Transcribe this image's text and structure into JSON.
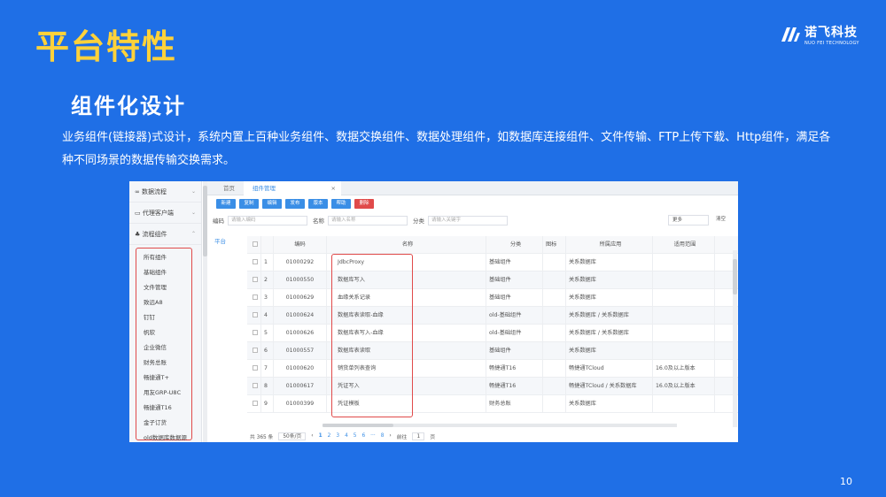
{
  "slide": {
    "title": "平台特性",
    "section_title": "组件化设计",
    "description": "业务组件(链接器)式设计，系统内置上百种业务组件、数据交换组件、数据处理组件，如数据库连接组件、文件传输、FTP上传下载、Http组件，满足各种不同场景的数据传输交换需求。",
    "page_number": "10",
    "logo_main": "诺飞科技",
    "logo_sub": "NUO FEI TECHNOLOGY"
  },
  "app": {
    "sidebar": {
      "groups": [
        {
          "label": "∞ 数据流程",
          "chevron": "⌄"
        },
        {
          "label": "▭ 代理客户端",
          "chevron": "⌄"
        },
        {
          "label": "♣ 流程组件",
          "chevron": "⌃"
        }
      ],
      "items": [
        "所有组件",
        "基础组件",
        "文件管理",
        "致远A8",
        "钉钉",
        "帆软",
        "企业微信",
        "财务总账",
        "畅捷通T+",
        "用友GRP-U8C",
        "畅捷通T16",
        "金子订货",
        "old数据库数据源"
      ]
    },
    "tabs": [
      {
        "label": "首页",
        "active": false
      },
      {
        "label": "组件管理",
        "active": true,
        "close": "×"
      }
    ],
    "toolbar": [
      "新建",
      "复制",
      "编辑",
      "发布",
      "版本",
      "帮助",
      "删除"
    ],
    "filter": {
      "code_label": "编码",
      "code_placeholder": "请输入编码",
      "name_label": "名称",
      "name_placeholder": "请输入名称",
      "cat_label": "分类",
      "cat_placeholder": "请输入关键字",
      "view_select": "更多",
      "clear_label": "清空"
    },
    "left_tag": "平台",
    "table": {
      "headers": {
        "code": "编码",
        "name": "名称",
        "cat": "分类",
        "mark": "图标",
        "app": "所属应用",
        "range": "适用范围"
      },
      "rows": [
        {
          "idx": "1",
          "code": "01000292",
          "name": "JdbcProxy",
          "cat": "基础组件",
          "app": "关系数据库",
          "range": ""
        },
        {
          "idx": "2",
          "code": "01000550",
          "name": "数据库写入",
          "cat": "基础组件",
          "app": "关系数据库",
          "range": ""
        },
        {
          "idx": "3",
          "code": "01000629",
          "name": "血缘关系记录",
          "cat": "基础组件",
          "app": "关系数据库",
          "range": ""
        },
        {
          "idx": "4",
          "code": "01000624",
          "name": "数据库表读取-血缘",
          "cat": "old-基础组件",
          "app": "关系数据库 / 关系数据库",
          "range": ""
        },
        {
          "idx": "5",
          "code": "01000626",
          "name": "数据库表写入-血缘",
          "cat": "old-基础组件",
          "app": "关系数据库 / 关系数据库",
          "range": ""
        },
        {
          "idx": "6",
          "code": "01000557",
          "name": "数据库表读取",
          "cat": "基础组件",
          "app": "关系数据库",
          "range": ""
        },
        {
          "idx": "7",
          "code": "01000620",
          "name": "销货单列表查询",
          "cat": "畅捷通T16",
          "app": "畅捷通TCloud",
          "range": "16.0及以上版本"
        },
        {
          "idx": "8",
          "code": "01000617",
          "name": "凭证写入",
          "cat": "畅捷通T16",
          "app": "畅捷通TCloud / 关系数据库",
          "range": "16.0及以上版本"
        },
        {
          "idx": "9",
          "code": "01000399",
          "name": "凭证模板",
          "cat": "财务总账",
          "app": "关系数据库",
          "range": ""
        }
      ]
    },
    "pager": {
      "total": "共 365 条",
      "page_size": "50条/页",
      "prev": "‹",
      "pages": [
        "1",
        "2",
        "3",
        "4",
        "5",
        "6",
        "···",
        "8"
      ],
      "next": "›",
      "goto_label": "前往",
      "goto_value": "1",
      "goto_unit": "页"
    }
  }
}
